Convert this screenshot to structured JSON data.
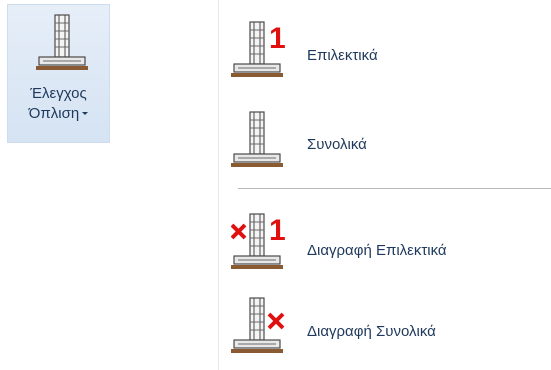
{
  "ribbon_button": {
    "line1": "Έλεγχος",
    "line2": "Όπλιση",
    "icon": "column-footing-icon"
  },
  "menu": {
    "items": [
      {
        "label": "Επιλεκτικά",
        "icon": "column-footing-one-icon",
        "badge": "1"
      },
      {
        "label": "Συνολικά",
        "icon": "column-footing-icon"
      },
      {
        "label": "Διαγραφή Επιλεκτικά",
        "icon": "delete-column-footing-one-icon",
        "badge": "1"
      },
      {
        "label": "Διαγραφή Συνολικά",
        "icon": "delete-column-footing-icon"
      }
    ]
  },
  "colors": {
    "accent_red": "#e01010",
    "label_text": "#1e395b",
    "ribbon_bg": "#dce7f5"
  }
}
